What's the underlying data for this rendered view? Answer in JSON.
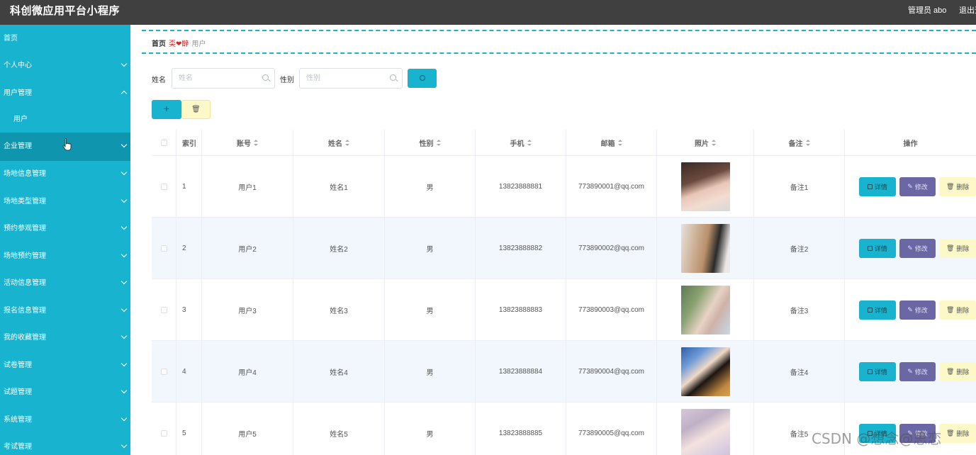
{
  "header": {
    "title": "科创微应用平台小程序",
    "user": "管理员 abo",
    "logout": "退出登录"
  },
  "sidebar": {
    "items": [
      {
        "label": "首页",
        "chevron": "none"
      },
      {
        "label": "个人中心",
        "chevron": "down"
      },
      {
        "label": "用户管理",
        "chevron": "up"
      },
      {
        "label": "用户",
        "chevron": "none"
      },
      {
        "label": "企业管理",
        "chevron": "down"
      },
      {
        "label": "场地信息管理",
        "chevron": "down"
      },
      {
        "label": "场地类型管理",
        "chevron": "down"
      },
      {
        "label": "预约参观管理",
        "chevron": "down"
      },
      {
        "label": "场地预约管理",
        "chevron": "down"
      },
      {
        "label": "活动信息管理",
        "chevron": "down"
      },
      {
        "label": "报名信息管理",
        "chevron": "down"
      },
      {
        "label": "我的收藏管理",
        "chevron": "down"
      },
      {
        "label": "试卷管理",
        "chevron": "down"
      },
      {
        "label": "试题管理",
        "chevron": "down"
      },
      {
        "label": "系统管理",
        "chevron": "down"
      },
      {
        "label": "考试管理",
        "chevron": "down"
      }
    ]
  },
  "breadcrumb": {
    "home": "首页",
    "separator": "奀❤辥",
    "current": "用户"
  },
  "search": {
    "name_label": "姓名",
    "name_placeholder": "姓名",
    "gender_label": "性别",
    "gender_placeholder": "性别"
  },
  "toolbar": {
    "add_label": "+",
    "delete_label": "🗑"
  },
  "table": {
    "headers": [
      "索引",
      "账号",
      "姓名",
      "性别",
      "手机",
      "邮箱",
      "照片",
      "备注",
      "操作"
    ],
    "rows": [
      {
        "index": "1",
        "account": "用户1",
        "name": "姓名1",
        "gender": "男",
        "phone": "13823888881",
        "email": "773890001@qq.com",
        "note": "备注1"
      },
      {
        "index": "2",
        "account": "用户2",
        "name": "姓名2",
        "gender": "男",
        "phone": "13823888882",
        "email": "773890002@qq.com",
        "note": "备注2"
      },
      {
        "index": "3",
        "account": "用户3",
        "name": "姓名3",
        "gender": "男",
        "phone": "13823888883",
        "email": "773890003@qq.com",
        "note": "备注3"
      },
      {
        "index": "4",
        "account": "用户4",
        "name": "姓名4",
        "gender": "男",
        "phone": "13823888884",
        "email": "773890004@qq.com",
        "note": "备注4"
      },
      {
        "index": "5",
        "account": "用户5",
        "name": "姓名5",
        "gender": "男",
        "phone": "13823888885",
        "email": "773890005@qq.com",
        "note": "备注5"
      }
    ],
    "actions": {
      "detail": "详情",
      "edit": "修改",
      "remove": "删除"
    }
  },
  "watermark": "CSDN @想念@思恋",
  "colors": {
    "accent": "#17b3cf",
    "topbar": "#404040",
    "edit": "#6a67a4",
    "remove": "#fcf8c8"
  }
}
